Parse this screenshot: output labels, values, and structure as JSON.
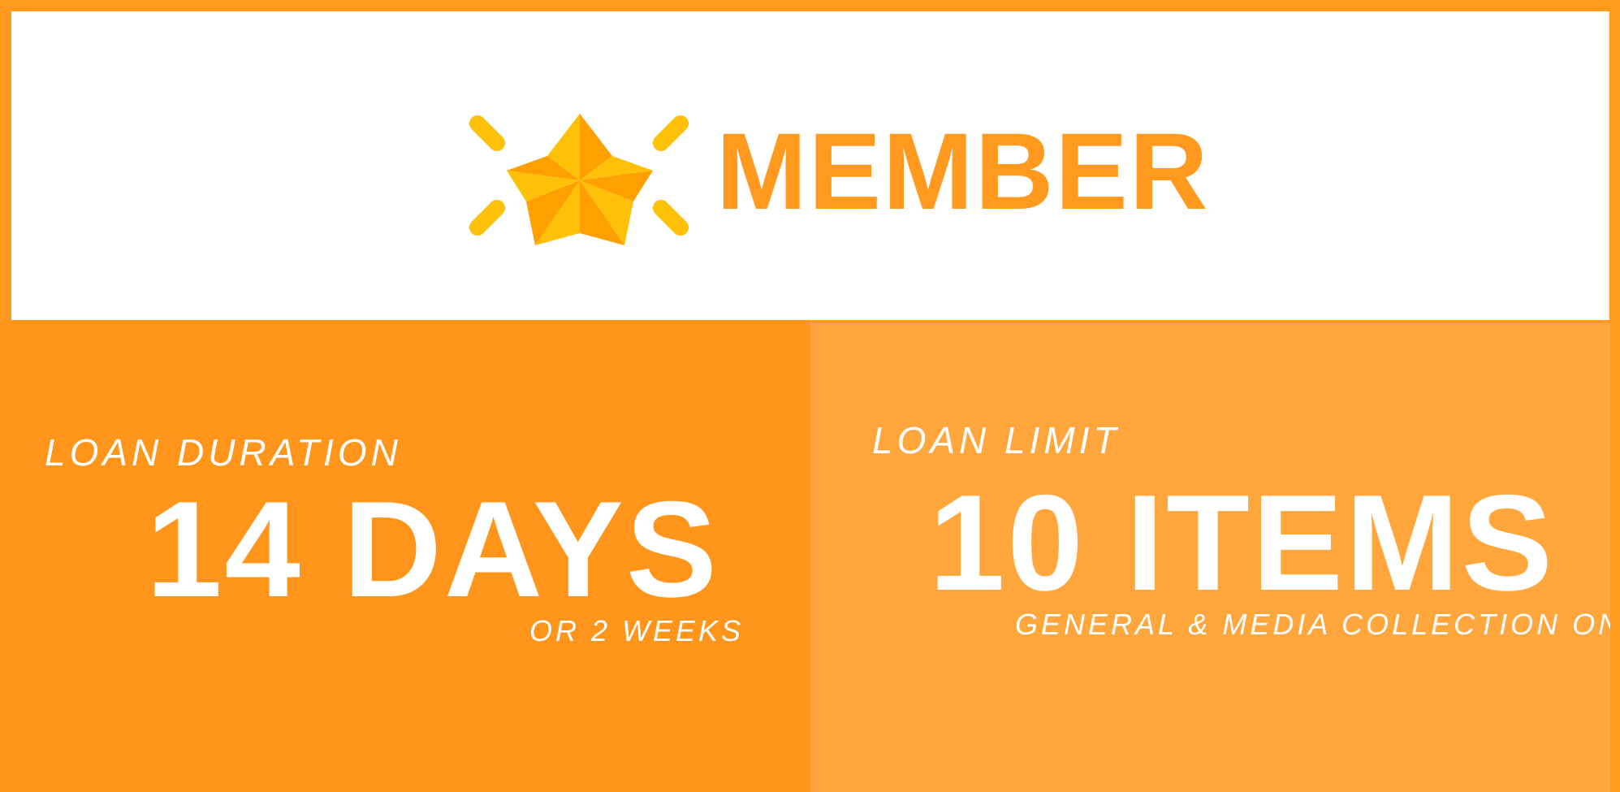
{
  "header": {
    "title": "MEMBER",
    "icon": "star-sparkle-icon"
  },
  "loan_duration": {
    "label": "LOAN DURATION",
    "value": "14 DAYS",
    "note": "OR 2 WEEKS"
  },
  "loan_limit": {
    "label": "LOAN LIMIT",
    "value": "10 ITEMS",
    "note": "GENERAL & MEDIA COLLECTION ONLY"
  },
  "colors": {
    "accent": "#ff9a1e",
    "panel_left": "#ff961b",
    "panel_right": "#ffa63d",
    "star_light": "#ffc107",
    "star_dark": "#ffa000",
    "background": "#ffffff"
  }
}
